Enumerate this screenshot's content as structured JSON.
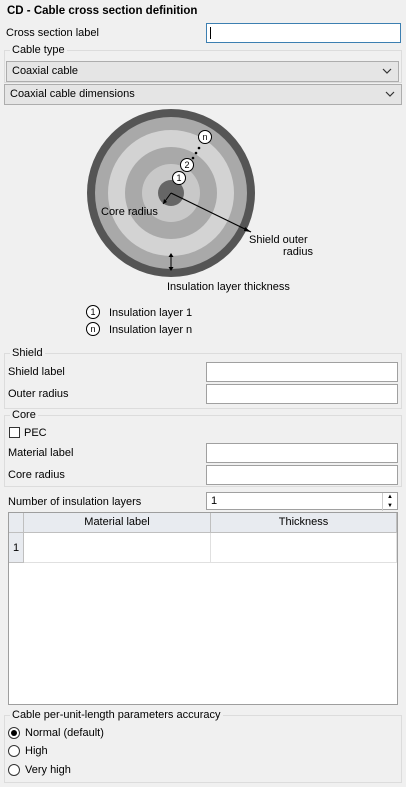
{
  "window": {
    "title": "CD - Cable cross section definition"
  },
  "cross_section": {
    "label": "Cross section label",
    "value": ""
  },
  "cable_type": {
    "group_title": "Cable type",
    "selected": "Coaxial cable"
  },
  "dimensions_combo": {
    "selected": "Coaxial cable dimensions"
  },
  "diagram": {
    "marker_1": "1",
    "marker_2": "2",
    "marker_n": "n",
    "core_radius": "Core radius",
    "shield_outer_radius_line1": "Shield outer",
    "shield_outer_radius_line2": "radius",
    "insulation_thickness": "Insulation layer thickness",
    "legend_1_marker": "1",
    "legend_1": "Insulation layer 1",
    "legend_n_marker": "n",
    "legend_n": "Insulation layer n",
    "colors": {
      "outer": "#555555",
      "mid": "#a9a9a9",
      "light": "#d3d3d3",
      "core": "#666666"
    }
  },
  "shield": {
    "group_title": "Shield",
    "label_field": "Shield label",
    "outer_radius_field": "Outer radius"
  },
  "core": {
    "group_title": "Core",
    "pec_label": "PEC",
    "pec_checked": false,
    "material_label_field": "Material label",
    "core_radius_field": "Core radius"
  },
  "insulation": {
    "label": "Number of insulation layers",
    "value": "1",
    "table": {
      "columns": [
        "Material label",
        "Thickness"
      ],
      "rows": [
        {
          "index": "1",
          "material": "",
          "thickness": ""
        }
      ]
    }
  },
  "accuracy": {
    "group_title": "Cable per-unit-length parameters accuracy",
    "options": [
      {
        "label": "Normal (default)",
        "selected": true
      },
      {
        "label": "High",
        "selected": false
      },
      {
        "label": "Very high",
        "selected": false
      }
    ]
  }
}
